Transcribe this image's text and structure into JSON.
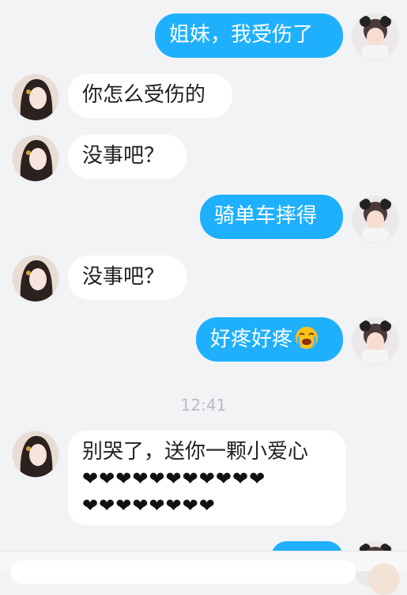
{
  "colors": {
    "outgoing": "#1fb0fd",
    "incoming": "#ffffff",
    "background": "#f2f3f5"
  },
  "messages": [
    {
      "side": "out",
      "text": "姐妹，我受伤了"
    },
    {
      "side": "in",
      "text": "你怎么受伤的"
    },
    {
      "side": "in",
      "text": "没事吧？"
    },
    {
      "side": "out",
      "text": "骑单车摔得"
    },
    {
      "side": "in",
      "text": "没事吧？"
    },
    {
      "side": "out",
      "text": "好疼好疼",
      "emoji": "crying-face-emoji"
    }
  ],
  "timestamp": "12:41",
  "last_message": {
    "side": "in",
    "text": "别哭了，送你一颗小爱心",
    "hearts_line1": "❤❤❤❤❤❤❤❤❤❤❤",
    "hearts_line2": "❤❤❤❤❤❤❤❤"
  }
}
